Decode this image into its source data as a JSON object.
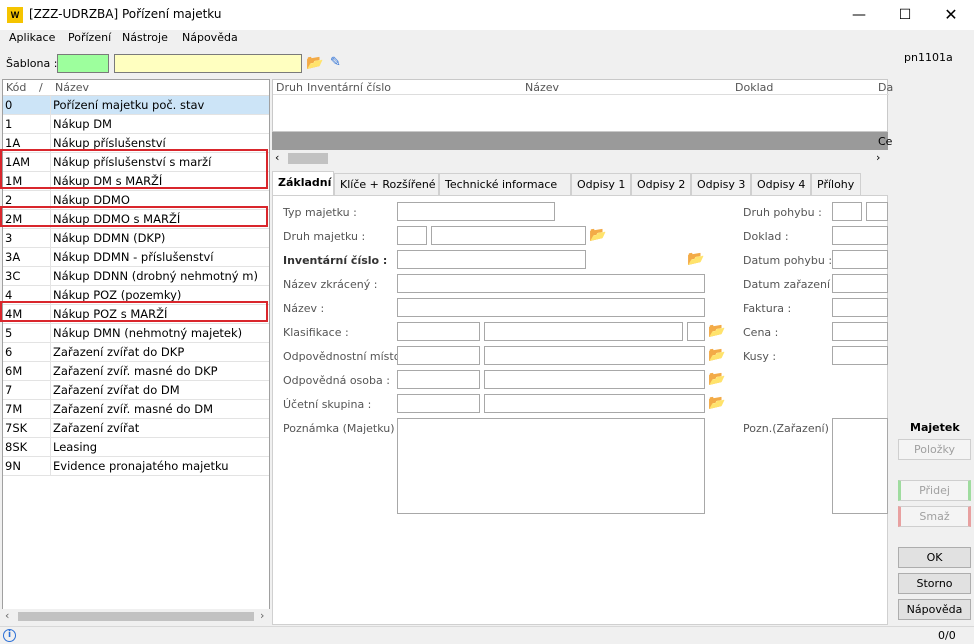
{
  "window": {
    "title": "[ZZZ-UDRZBA] Pořízení majetku",
    "icon_text": "W"
  },
  "menu": [
    "Aplikace",
    "Pořízení",
    "Nástroje",
    "Nápověda"
  ],
  "toolbar": {
    "sablona_label": "Šablona :"
  },
  "form_code": "pn1101a",
  "list": {
    "col_kod": "Kód",
    "col_sort": "/",
    "col_nazev": "Název",
    "rows": [
      {
        "kod": "0",
        "nazev": "Pořízení majetku poč. stav"
      },
      {
        "kod": "1",
        "nazev": "Nákup DM"
      },
      {
        "kod": "1A",
        "nazev": "Nákup příslušenství"
      },
      {
        "kod": "1AM",
        "nazev": "Nákup příslušenství s marží"
      },
      {
        "kod": "1M",
        "nazev": "Nákup DM s MARŽÍ"
      },
      {
        "kod": "2",
        "nazev": "Nákup DDMO"
      },
      {
        "kod": "2M",
        "nazev": "Nákup DDMO s MARŽÍ"
      },
      {
        "kod": "3",
        "nazev": "Nákup DDMN (DKP)"
      },
      {
        "kod": "3A",
        "nazev": "Nákup DDMN - příslušenství"
      },
      {
        "kod": "3C",
        "nazev": "Nákup DDNN (drobný nehmotný m)"
      },
      {
        "kod": "4",
        "nazev": "Nákup POZ (pozemky)"
      },
      {
        "kod": "4M",
        "nazev": "Nákup POZ s MARŽÍ"
      },
      {
        "kod": "5",
        "nazev": "Nákup DMN (nehmotný majetek)"
      },
      {
        "kod": "6",
        "nazev": "Zařazení zvířat do DKP"
      },
      {
        "kod": "6M",
        "nazev": "Zařazení zvíř. masné do DKP"
      },
      {
        "kod": "7",
        "nazev": "Zařazení zvířat do DM"
      },
      {
        "kod": "7M",
        "nazev": "Zařazení zvíř. masné do DM"
      },
      {
        "kod": "7SK",
        "nazev": "Zařazení zvířat"
      },
      {
        "kod": "8SK",
        "nazev": "Leasing"
      },
      {
        "kod": "9N",
        "nazev": "Evidence pronajatého majetku"
      }
    ]
  },
  "grid": {
    "columns": [
      "Druh",
      "Inventární číslo",
      "Název",
      "Doklad",
      "Da"
    ],
    "bar_text": "Ce"
  },
  "tabs": [
    "Základní",
    "Klíče + Rozšířené",
    "Technické informace",
    "Odpisy 1",
    "Odpisy 2",
    "Odpisy 3",
    "Odpisy 4",
    "Přílohy"
  ],
  "form": {
    "typ_majetku": "Typ majetku :",
    "druh_majetku": "Druh majetku :",
    "inventarni_cislo": "Inventární číslo :",
    "nazev_zkraceny": "Název zkrácený :",
    "nazev": "Název :",
    "klasifikace": "Klasifikace :",
    "odpovednostni_misto": "Odpovědnostní místo :",
    "odpovedna_osoba": "Odpovědná osoba :",
    "ucetni_skupina": "Účetní skupina :",
    "poznamka": "Poznámka (Majetku) :",
    "druh_pohybu": "Druh pohybu :",
    "doklad": "Doklad :",
    "datum_pohybu": "Datum pohybu :",
    "datum_zarazeni": "Datum zařazení :",
    "faktura": "Faktura :",
    "cena": "Cena :",
    "kusy": "Kusy :",
    "pozn_zarazeni": "Pozn.(Zařazení) :"
  },
  "side": {
    "majetek": "Majetek",
    "polozky": "Položky",
    "pridej": "Přidej",
    "smaz": "Smaž",
    "ok": "OK",
    "storno": "Storno",
    "napoveda": "Nápověda"
  },
  "status": {
    "counter": "0/0"
  }
}
